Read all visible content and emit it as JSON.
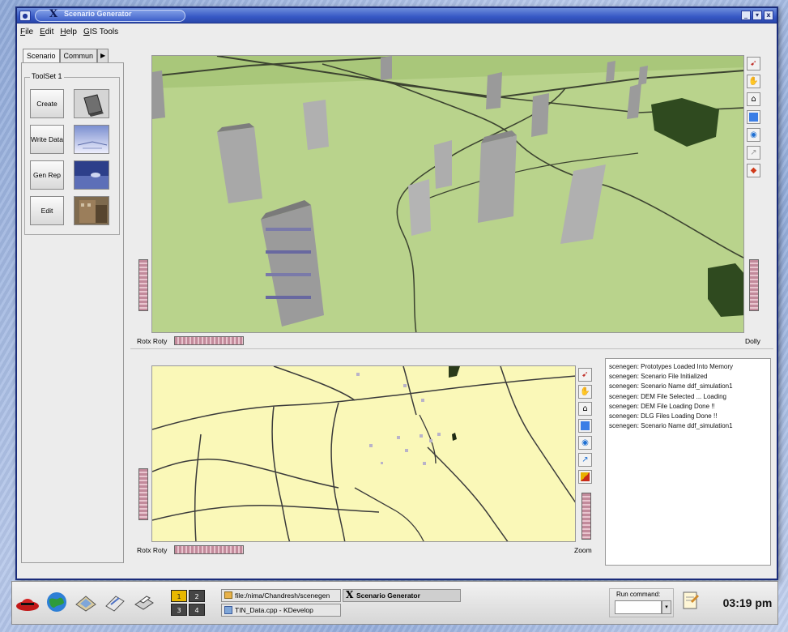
{
  "window": {
    "title": "Scenario Generator",
    "title_prefix": "X",
    "buttons": [
      "_",
      "▾",
      "x"
    ]
  },
  "menubar": [
    "File",
    "Edit",
    "Help",
    "GIS Tools"
  ],
  "left_panel": {
    "tabs": [
      "Scenario",
      "Commun"
    ],
    "toolset_label": "ToolSet 1",
    "buttons": [
      {
        "label": "Create"
      },
      {
        "label": "Write Data"
      },
      {
        "label": "Gen Rep"
      },
      {
        "label": "Edit"
      }
    ]
  },
  "view3d": {
    "left_label": "Rotx Roty",
    "right_label": "Dolly"
  },
  "view2d": {
    "left_label": "Rotx Roty",
    "right_label": "Zoom"
  },
  "log": [
    "scenegen: Prototypes Loaded Into Memory",
    "scenegen: Scenario File Initialized",
    "scenegen: Scenario Name ddf_simulation1",
    "scenegen: DEM File Selected ... Loading",
    "scenegen: DEM File Loading Done !!",
    "scenegen: DLG Files Loading Done !!",
    "scenegen: Scenario Name ddf_simulation1"
  ],
  "taskbar": {
    "pager": [
      "1",
      "2",
      "3",
      "4"
    ],
    "active_desktop": "1",
    "tasks": [
      {
        "label": "file:/nima/Chandresh/scenegen",
        "active": false
      },
      {
        "label": "Scenario Generator",
        "prefix": "X",
        "active": true
      },
      {
        "label": "TIN_Data.cpp - KDevelop",
        "active": false
      }
    ],
    "run_command_label": "Run command:",
    "clock": "03:19 pm"
  },
  "colors": {
    "titlebar": "#3658c4",
    "terrain3d": "#b7d18a",
    "terrain2d": "#f9f7b2",
    "wheel": "#c28a9b"
  }
}
